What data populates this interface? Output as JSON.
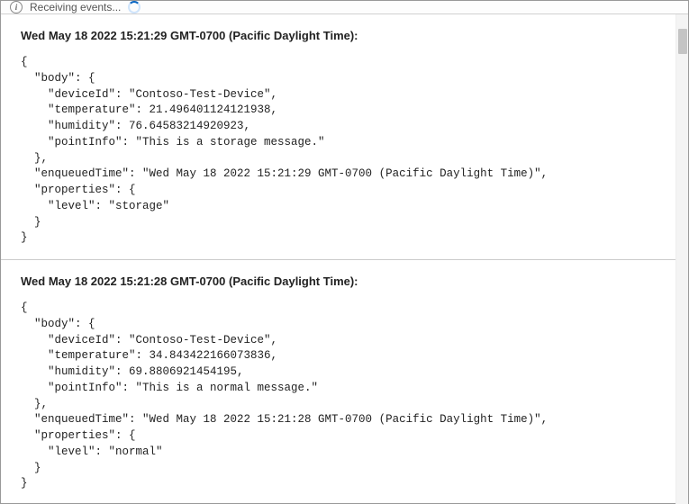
{
  "status": {
    "text": "Receiving events..."
  },
  "events": [
    {
      "header": "Wed May 18 2022 15:21:29 GMT-0700 (Pacific Daylight Time):",
      "body": "{\n  \"body\": {\n    \"deviceId\": \"Contoso-Test-Device\",\n    \"temperature\": 21.496401124121938,\n    \"humidity\": 76.64583214920923,\n    \"pointInfo\": \"This is a storage message.\"\n  },\n  \"enqueuedTime\": \"Wed May 18 2022 15:21:29 GMT-0700 (Pacific Daylight Time)\",\n  \"properties\": {\n    \"level\": \"storage\"\n  }\n}"
    },
    {
      "header": "Wed May 18 2022 15:21:28 GMT-0700 (Pacific Daylight Time):",
      "body": "{\n  \"body\": {\n    \"deviceId\": \"Contoso-Test-Device\",\n    \"temperature\": 34.843422166073836,\n    \"humidity\": 69.8806921454195,\n    \"pointInfo\": \"This is a normal message.\"\n  },\n  \"enqueuedTime\": \"Wed May 18 2022 15:21:28 GMT-0700 (Pacific Daylight Time)\",\n  \"properties\": {\n    \"level\": \"normal\"\n  }\n}"
    }
  ]
}
